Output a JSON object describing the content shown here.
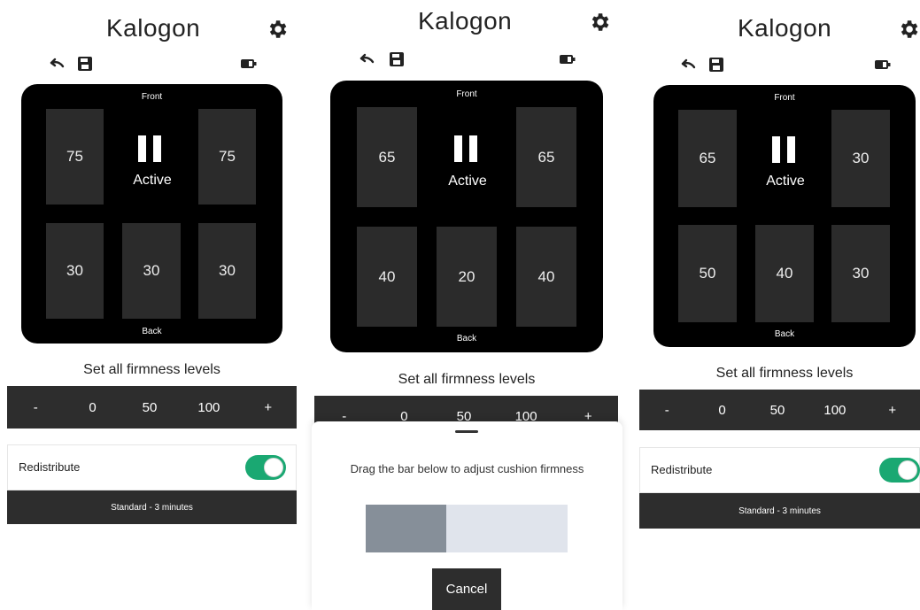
{
  "app_title": "Kalogon",
  "icons": {
    "settings": "gear-icon",
    "undo": "undo-icon",
    "save": "save-icon",
    "battery": "battery-icon",
    "pause": "pause-icon"
  },
  "colors": {
    "toggle_on": "#1aa872",
    "cushion_bg": "#000000",
    "cell_bg": "#2b2b2b",
    "bar_bg": "#2d2d2d"
  },
  "screens": [
    {
      "front_label": "Front",
      "back_label": "Back",
      "status": "Active",
      "cells": [
        "75",
        "75",
        "30",
        "30",
        "30"
      ],
      "firmness_title": "Set all firmness levels",
      "firmness_options": [
        "-",
        "0",
        "50",
        "100",
        "+"
      ],
      "redistribute_label": "Redistribute",
      "redistribute_on": true,
      "mode_label": "Standard - 3 minutes"
    },
    {
      "front_label": "Front",
      "back_label": "Back",
      "status": "Active",
      "cells": [
        "65",
        "65",
        "40",
        "20",
        "40"
      ],
      "firmness_title": "Set all firmness levels",
      "firmness_options": [
        "-",
        "0",
        "50",
        "100",
        "+"
      ],
      "sheet_text": "Drag the bar below to adjust cushion firmness",
      "slider_level": 0.4,
      "cancel_label": "Cancel"
    },
    {
      "front_label": "Front",
      "back_label": "Back",
      "status": "Active",
      "cells": [
        "65",
        "30",
        "50",
        "40",
        "30"
      ],
      "firmness_title": "Set all firmness levels",
      "firmness_options": [
        "-",
        "0",
        "50",
        "100",
        "+"
      ],
      "redistribute_label": "Redistribute",
      "redistribute_on": true,
      "mode_label": "Standard - 3 minutes"
    }
  ]
}
